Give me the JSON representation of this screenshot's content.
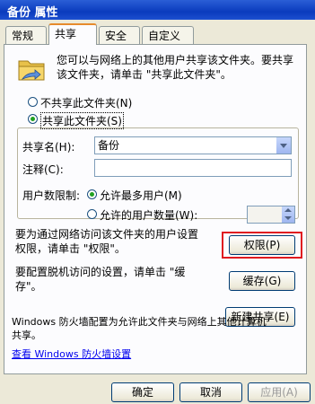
{
  "window": {
    "title": "备份 属性"
  },
  "tabs": [
    {
      "label": "常规"
    },
    {
      "label": "共享",
      "active": true
    },
    {
      "label": "安全"
    },
    {
      "label": "自定义"
    }
  ],
  "intro": {
    "line1": "您可以与网络上的其他用户共享该文件夹。要共享",
    "line2": "该文件夹，请单击 \"共享此文件夹\"。"
  },
  "sharing": {
    "no_share_label": "不共享此文件夹(N)",
    "share_label": "共享此文件夹(S)",
    "selected": "share"
  },
  "share_name": {
    "label": "共享名(H):",
    "value": "备份"
  },
  "comment": {
    "label": "注释(C):",
    "value": ""
  },
  "user_limit": {
    "label": "用户数限制:",
    "max_label": "允许最多用户(M)",
    "allow_label": "允许的用户数量(W):",
    "selected": "max",
    "count": ""
  },
  "permissions": {
    "text1": "要为通过网络访问该文件夹的用户设置",
    "text2": "权限，请单击 \"权限\"。",
    "button": "权限(P)"
  },
  "offline": {
    "text1": "要配置脱机访问的设置，请单击 \"缓",
    "text2": "存\"。",
    "button": "缓存(G)"
  },
  "new_share_button": "新建共享(E)",
  "firewall": {
    "text1": "Windows 防火墙配置为允许此文件夹与网络上其他计算机",
    "text2": "共享。",
    "link": "查看 Windows 防火墙设置"
  },
  "footer": {
    "ok": "确定",
    "cancel": "取消",
    "apply": "应用(A)"
  },
  "colors": {
    "highlight": "#e0191f",
    "titlebar": "#0a3bbd",
    "dialog_bg": "#ece9d8"
  }
}
